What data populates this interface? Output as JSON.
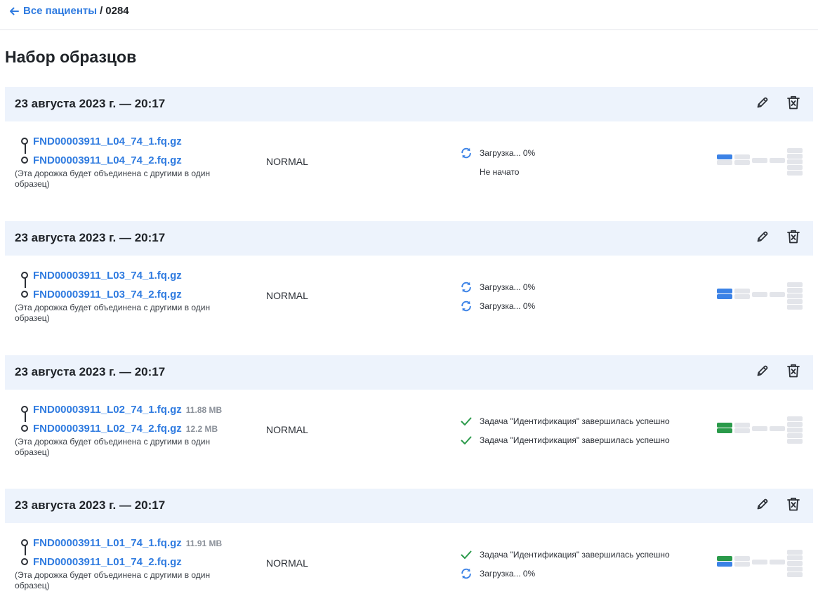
{
  "breadcrumb": {
    "back_label": "Все пациенты",
    "separator": "/",
    "current": "0284"
  },
  "page": {
    "title": "Набор образцов"
  },
  "colors": {
    "link": "#2f7be0",
    "done": "#2a9a4a",
    "in_progress": "#3b82e6",
    "pending": "#e3e5ea",
    "header_bg": "#edf3fc"
  },
  "cards": [
    {
      "date": "23 августа 2023 г. — 20:17",
      "files": [
        {
          "name": "FND00003911_L04_74_1.fq.gz",
          "size": ""
        },
        {
          "name": "FND00003911_L04_74_2.fq.gz",
          "size": ""
        }
      ],
      "note": "(Эта дорожка будет объединена с другими в один образец)",
      "type": "NORMAL",
      "statuses": [
        {
          "icon": "sync-icon",
          "text": "Загрузка... 0%"
        },
        {
          "icon": "",
          "text": "Не начато"
        }
      ],
      "pipeline": {
        "r1": "in_progress",
        "r2": "pending"
      }
    },
    {
      "date": "23 августа 2023 г. — 20:17",
      "files": [
        {
          "name": "FND00003911_L03_74_1.fq.gz",
          "size": ""
        },
        {
          "name": "FND00003911_L03_74_2.fq.gz",
          "size": ""
        }
      ],
      "note": "(Эта дорожка будет объединена с другими в один образец)",
      "type": "NORMAL",
      "statuses": [
        {
          "icon": "sync-icon",
          "text": "Загрузка... 0%"
        },
        {
          "icon": "sync-icon",
          "text": "Загрузка... 0%"
        }
      ],
      "pipeline": {
        "r1": "in_progress",
        "r2": "in_progress"
      }
    },
    {
      "date": "23 августа 2023 г. — 20:17",
      "files": [
        {
          "name": "FND00003911_L02_74_1.fq.gz",
          "size": "11.88 MB"
        },
        {
          "name": "FND00003911_L02_74_2.fq.gz",
          "size": "12.2 MB"
        }
      ],
      "note": "(Эта дорожка будет объединена с другими в один образец)",
      "type": "NORMAL",
      "statuses": [
        {
          "icon": "check-icon",
          "text": "Задача \"Идентификация\" завершилась успешно"
        },
        {
          "icon": "check-icon",
          "text": "Задача \"Идентификация\" завершилась успешно"
        }
      ],
      "pipeline": {
        "r1": "done",
        "r2": "done"
      }
    },
    {
      "date": "23 августа 2023 г. — 20:17",
      "files": [
        {
          "name": "FND00003911_L01_74_1.fq.gz",
          "size": "11.91 MB"
        },
        {
          "name": "FND00003911_L01_74_2.fq.gz",
          "size": ""
        }
      ],
      "note": "(Эта дорожка будет объединена с другими в один образец)",
      "type": "NORMAL",
      "statuses": [
        {
          "icon": "check-icon",
          "text": "Задача \"Идентификация\" завершилась успешно"
        },
        {
          "icon": "sync-icon",
          "text": "Загрузка... 0%"
        }
      ],
      "pipeline": {
        "r1": "done",
        "r2": "in_progress"
      }
    }
  ]
}
